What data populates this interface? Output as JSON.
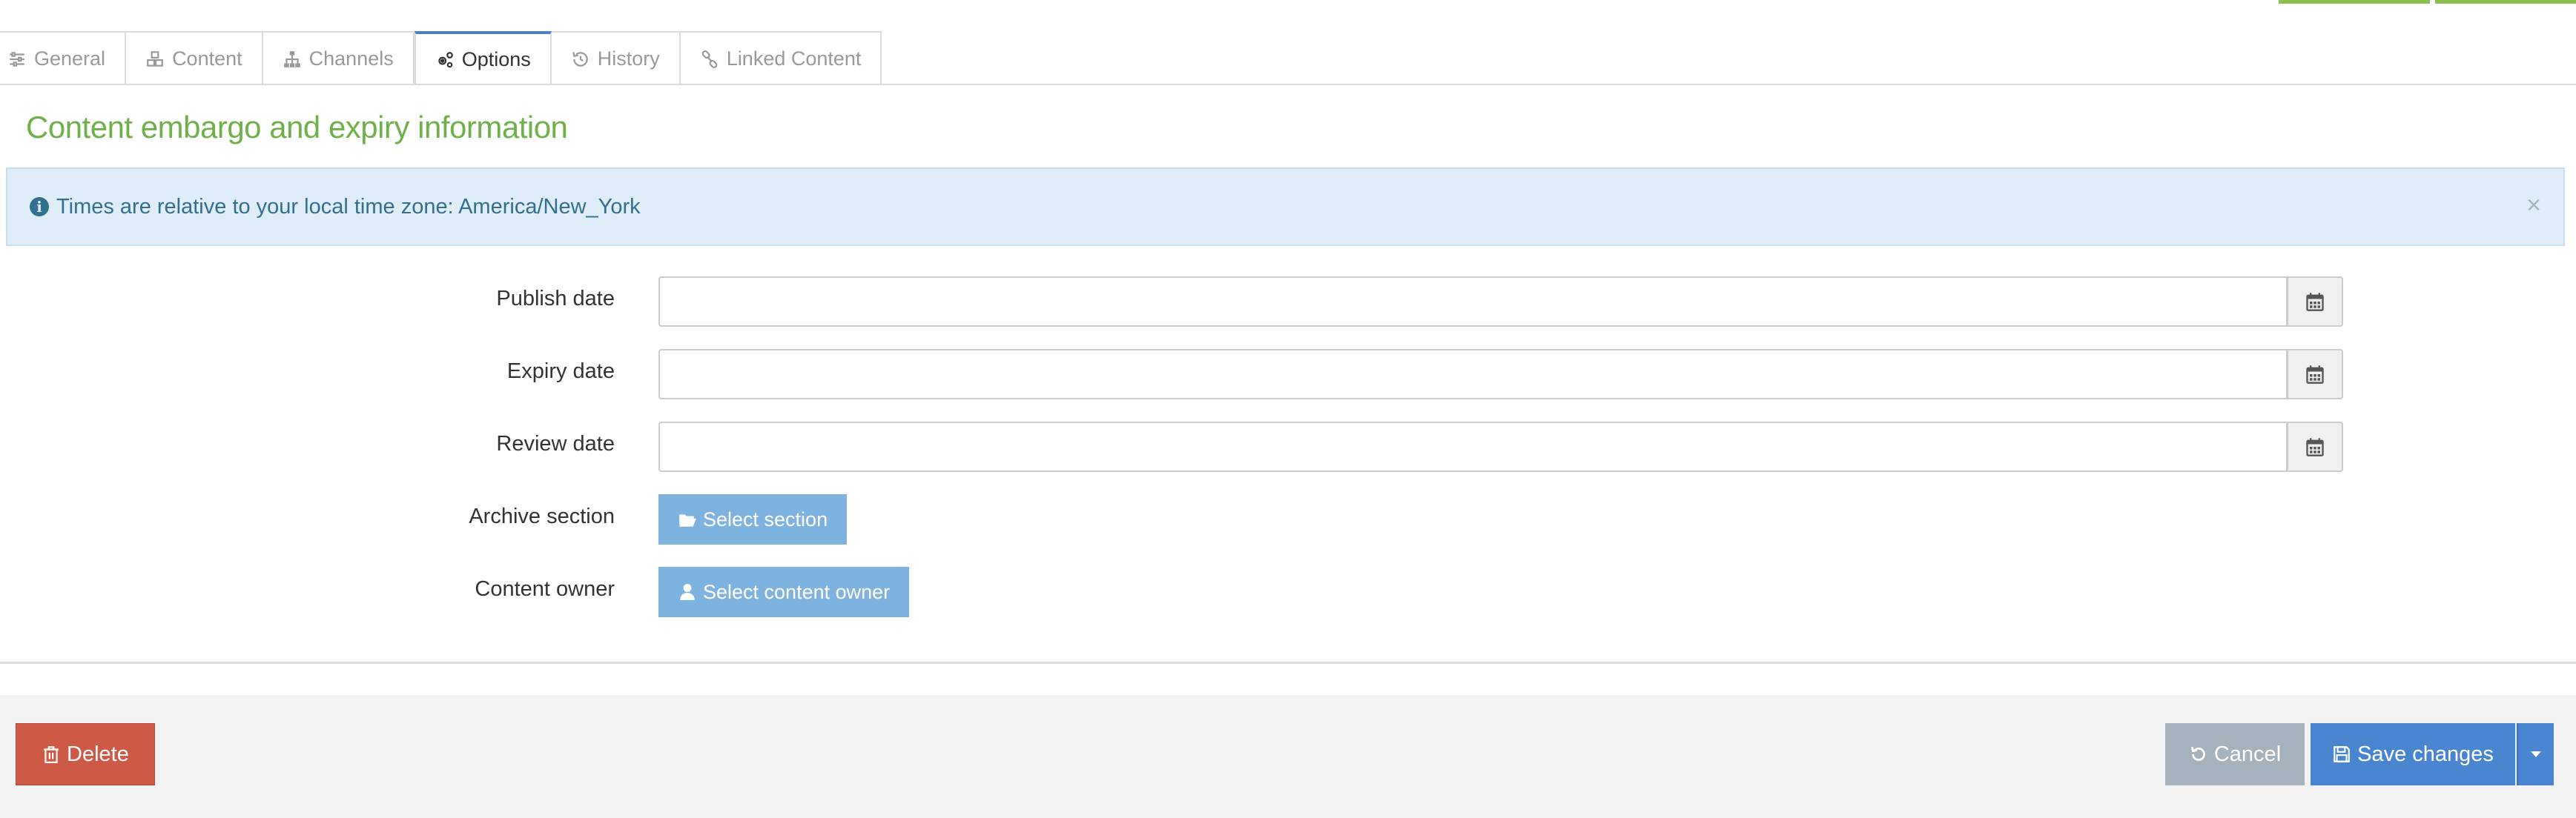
{
  "tabs": [
    {
      "label": "General",
      "icon": "sliders-icon"
    },
    {
      "label": "Content",
      "icon": "cubes-icon"
    },
    {
      "label": "Channels",
      "icon": "sitemap-icon"
    },
    {
      "label": "Options",
      "icon": "cogs-icon",
      "active": true
    },
    {
      "label": "History",
      "icon": "history-icon"
    },
    {
      "label": "Linked Content",
      "icon": "link-icon"
    }
  ],
  "section_title": "Content embargo and expiry information",
  "alert": {
    "text": "Times are relative to your local time zone: America/New_York",
    "close": "×"
  },
  "form": {
    "publish_date": {
      "label": "Publish date",
      "value": ""
    },
    "expiry_date": {
      "label": "Expiry date",
      "value": ""
    },
    "review_date": {
      "label": "Review date",
      "value": ""
    },
    "archive_section": {
      "label": "Archive section",
      "button": "Select section"
    },
    "content_owner": {
      "label": "Content owner",
      "button": "Select content owner"
    }
  },
  "footer": {
    "delete": "Delete",
    "cancel": "Cancel",
    "save": "Save changes"
  },
  "colors": {
    "accent_green": "#6fb04a",
    "primary_blue": "#4a86cf",
    "danger": "#cc5a47",
    "info_bg": "#deedf7"
  }
}
